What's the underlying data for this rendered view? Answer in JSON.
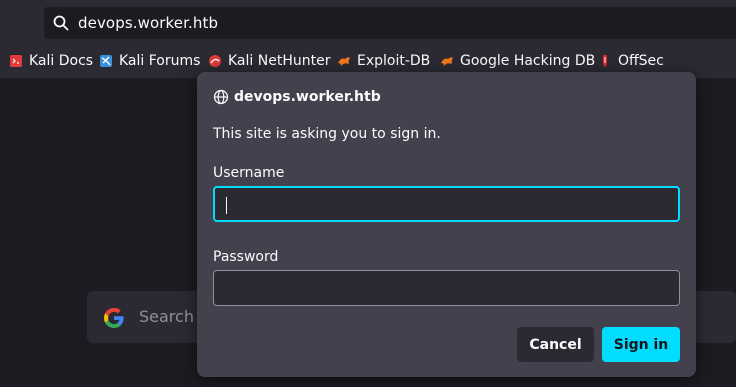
{
  "browser": {
    "url": "devops.worker.htb",
    "bookmarks": [
      {
        "label": "Kali Docs",
        "icon": "kali-docs-icon"
      },
      {
        "label": "Kali Forums",
        "icon": "kali-forums-icon"
      },
      {
        "label": "Kali NetHunter",
        "icon": "kali-nethunter-icon"
      },
      {
        "label": "Exploit-DB",
        "icon": "exploit-db-icon"
      },
      {
        "label": "Google Hacking DB",
        "icon": "google-hacking-db-icon"
      },
      {
        "label": "OffSec",
        "icon": "offsec-icon"
      }
    ]
  },
  "newtab": {
    "search_placeholder": "Search"
  },
  "auth_dialog": {
    "host": "devops.worker.htb",
    "message": "This site is asking you to sign in.",
    "username_label": "Username",
    "username_value": "",
    "password_label": "Password",
    "password_value": "",
    "cancel_label": "Cancel",
    "signin_label": "Sign in"
  },
  "colors": {
    "accent": "#00ddff",
    "dialog_bg": "#42414d",
    "toolbar_bg": "#2b2a33",
    "page_bg": "#1c1b22"
  }
}
